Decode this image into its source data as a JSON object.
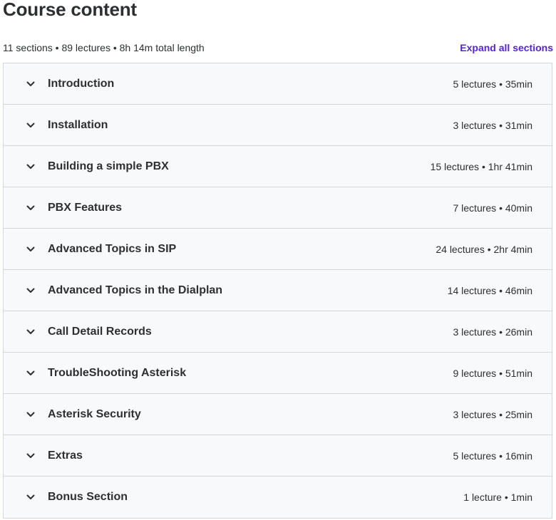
{
  "header": {
    "title": "Course content",
    "summary": "11 sections • 89 lectures • 8h 14m total length",
    "expand_all_label": "Expand all sections"
  },
  "colors": {
    "accent": "#5624d0",
    "section_bg": "#f7f9fa",
    "border": "#d1d7dc",
    "text": "#2d2f31"
  },
  "sections": [
    {
      "title": "Introduction",
      "meta": "5 lectures • 35min",
      "icon": "chevron-down-icon"
    },
    {
      "title": "Installation",
      "meta": "3 lectures • 31min",
      "icon": "chevron-down-icon"
    },
    {
      "title": "Building a simple PBX",
      "meta": "15 lectures • 1hr 41min",
      "icon": "chevron-down-icon"
    },
    {
      "title": "PBX Features",
      "meta": "7 lectures • 40min",
      "icon": "chevron-down-icon"
    },
    {
      "title": "Advanced Topics in SIP",
      "meta": "24 lectures • 2hr 4min",
      "icon": "chevron-down-icon"
    },
    {
      "title": "Advanced Topics in the Dialplan",
      "meta": "14 lectures • 46min",
      "icon": "chevron-down-icon"
    },
    {
      "title": "Call Detail Records",
      "meta": "3 lectures • 26min",
      "icon": "chevron-down-icon"
    },
    {
      "title": "TroubleShooting Asterisk",
      "meta": "9 lectures • 51min",
      "icon": "chevron-down-icon"
    },
    {
      "title": "Asterisk Security",
      "meta": "3 lectures • 25min",
      "icon": "chevron-down-icon"
    },
    {
      "title": "Extras",
      "meta": "5 lectures • 16min",
      "icon": "chevron-down-icon"
    },
    {
      "title": "Bonus Section",
      "meta": "1 lecture • 1min",
      "icon": "chevron-down-icon"
    }
  ]
}
